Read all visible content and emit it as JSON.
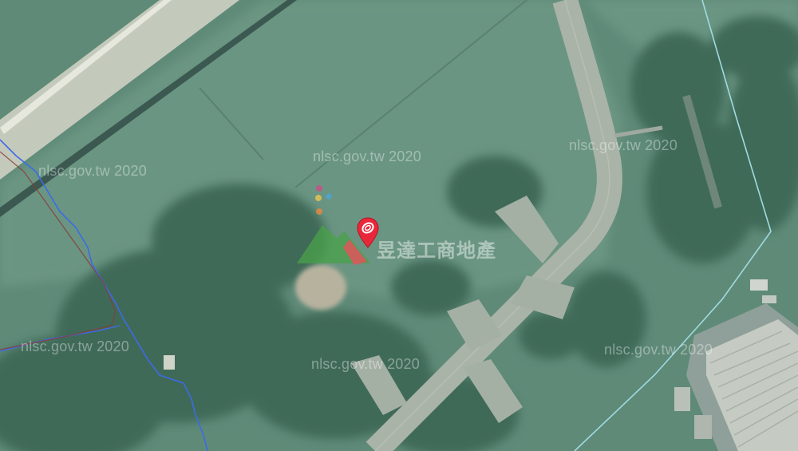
{
  "map": {
    "watermark": "nlsc.gov.tw 2020",
    "logo_text": "昱達工商地產",
    "marker_icon": "location-pin-icon",
    "colors": {
      "vegetation": "#5f8a78",
      "runway": "#a9b3a8",
      "boundary_line": "#9fdbe0",
      "stream_line": "#3b6be8",
      "marker": "#e8283a"
    }
  }
}
